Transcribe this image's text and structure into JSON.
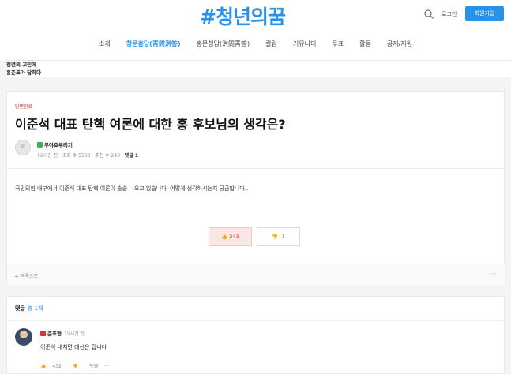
{
  "header": {
    "logo": "#청년의꿈",
    "login_label": "로그인",
    "signup_label": "회원가입",
    "accent_color": "#2a92e6"
  },
  "nav": {
    "items": [
      "소개",
      "청문홍답(靑問洪答)",
      "홍문청답(洪問靑答)",
      "칼럼",
      "커뮤니티",
      "투표",
      "활동",
      "공지/지원"
    ],
    "active_index": 1
  },
  "breadcrumb": {
    "line1": "청년의 고민에",
    "line2": "홍준표가 답하다"
  },
  "post": {
    "status_tag": "답변완료",
    "title": "이준석 대표 탄핵 여론에 대한 홍 후보님의 생각은?",
    "author": "무야호루리기",
    "time": "16시간 전",
    "views_label": "조회 수 5503",
    "recommend_label": "추천 수 243",
    "comment_label": "댓글 1",
    "body": "국민의힘 내부에서 이준석 대표 탄핵 여론이 솔솔 나오고 있습니다. 어떻게 생각하시는지 궁금합니다..",
    "like_count": "243",
    "dislike_count": "-1",
    "back_label": "목록으로",
    "more_label": "···"
  },
  "comments": {
    "header": "댓글",
    "count": "총 1개",
    "items": [
      {
        "author": "준표형",
        "time": "15시간 전",
        "text": "이준석 내치면 대선은 집니다",
        "likes": "432",
        "reply_label": "댓글",
        "more_label": "···"
      }
    ]
  }
}
